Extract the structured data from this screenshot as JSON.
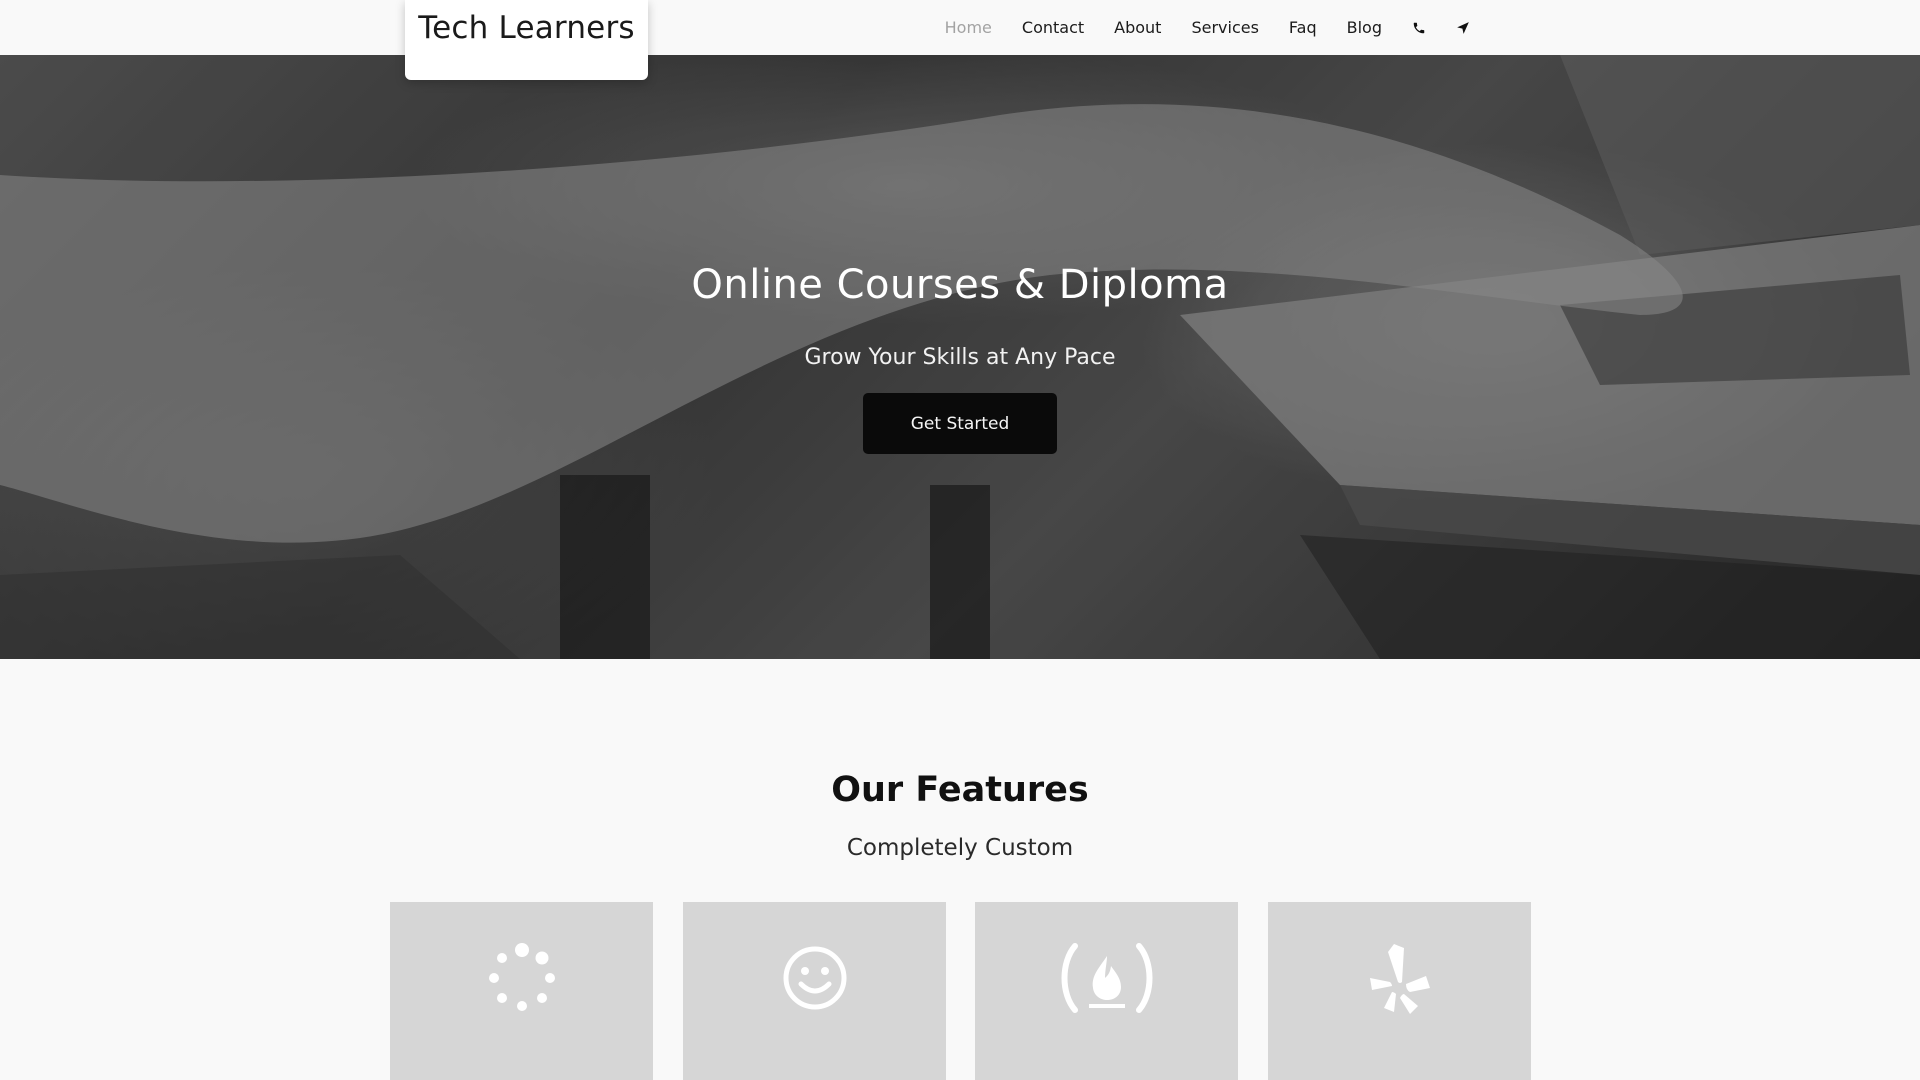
{
  "brand": {
    "name": "Tech Learners"
  },
  "nav": {
    "items": [
      {
        "label": "Home",
        "active": true
      },
      {
        "label": "Contact",
        "active": false
      },
      {
        "label": "About",
        "active": false
      },
      {
        "label": "Services",
        "active": false
      },
      {
        "label": "Faq",
        "active": false
      },
      {
        "label": "Blog",
        "active": false
      }
    ],
    "icons": [
      "phone-icon",
      "location-arrow-icon"
    ]
  },
  "hero": {
    "title": "Online Courses & Diploma",
    "subtitle": "Grow Your Skills at Any Pace",
    "cta_label": "Get Started"
  },
  "features": {
    "title": "Our Features",
    "subtitle": "Completely Custom",
    "cards": [
      {
        "icon": "spinner-icon"
      },
      {
        "icon": "smile-icon"
      },
      {
        "icon": "free-code-camp-icon"
      },
      {
        "icon": "yelp-icon"
      }
    ]
  },
  "colors": {
    "background": "#f9f9f9",
    "nav_active": "#a3a3a3",
    "cta_background": "#0a0a0a",
    "card_background": "#d6d6d6"
  }
}
